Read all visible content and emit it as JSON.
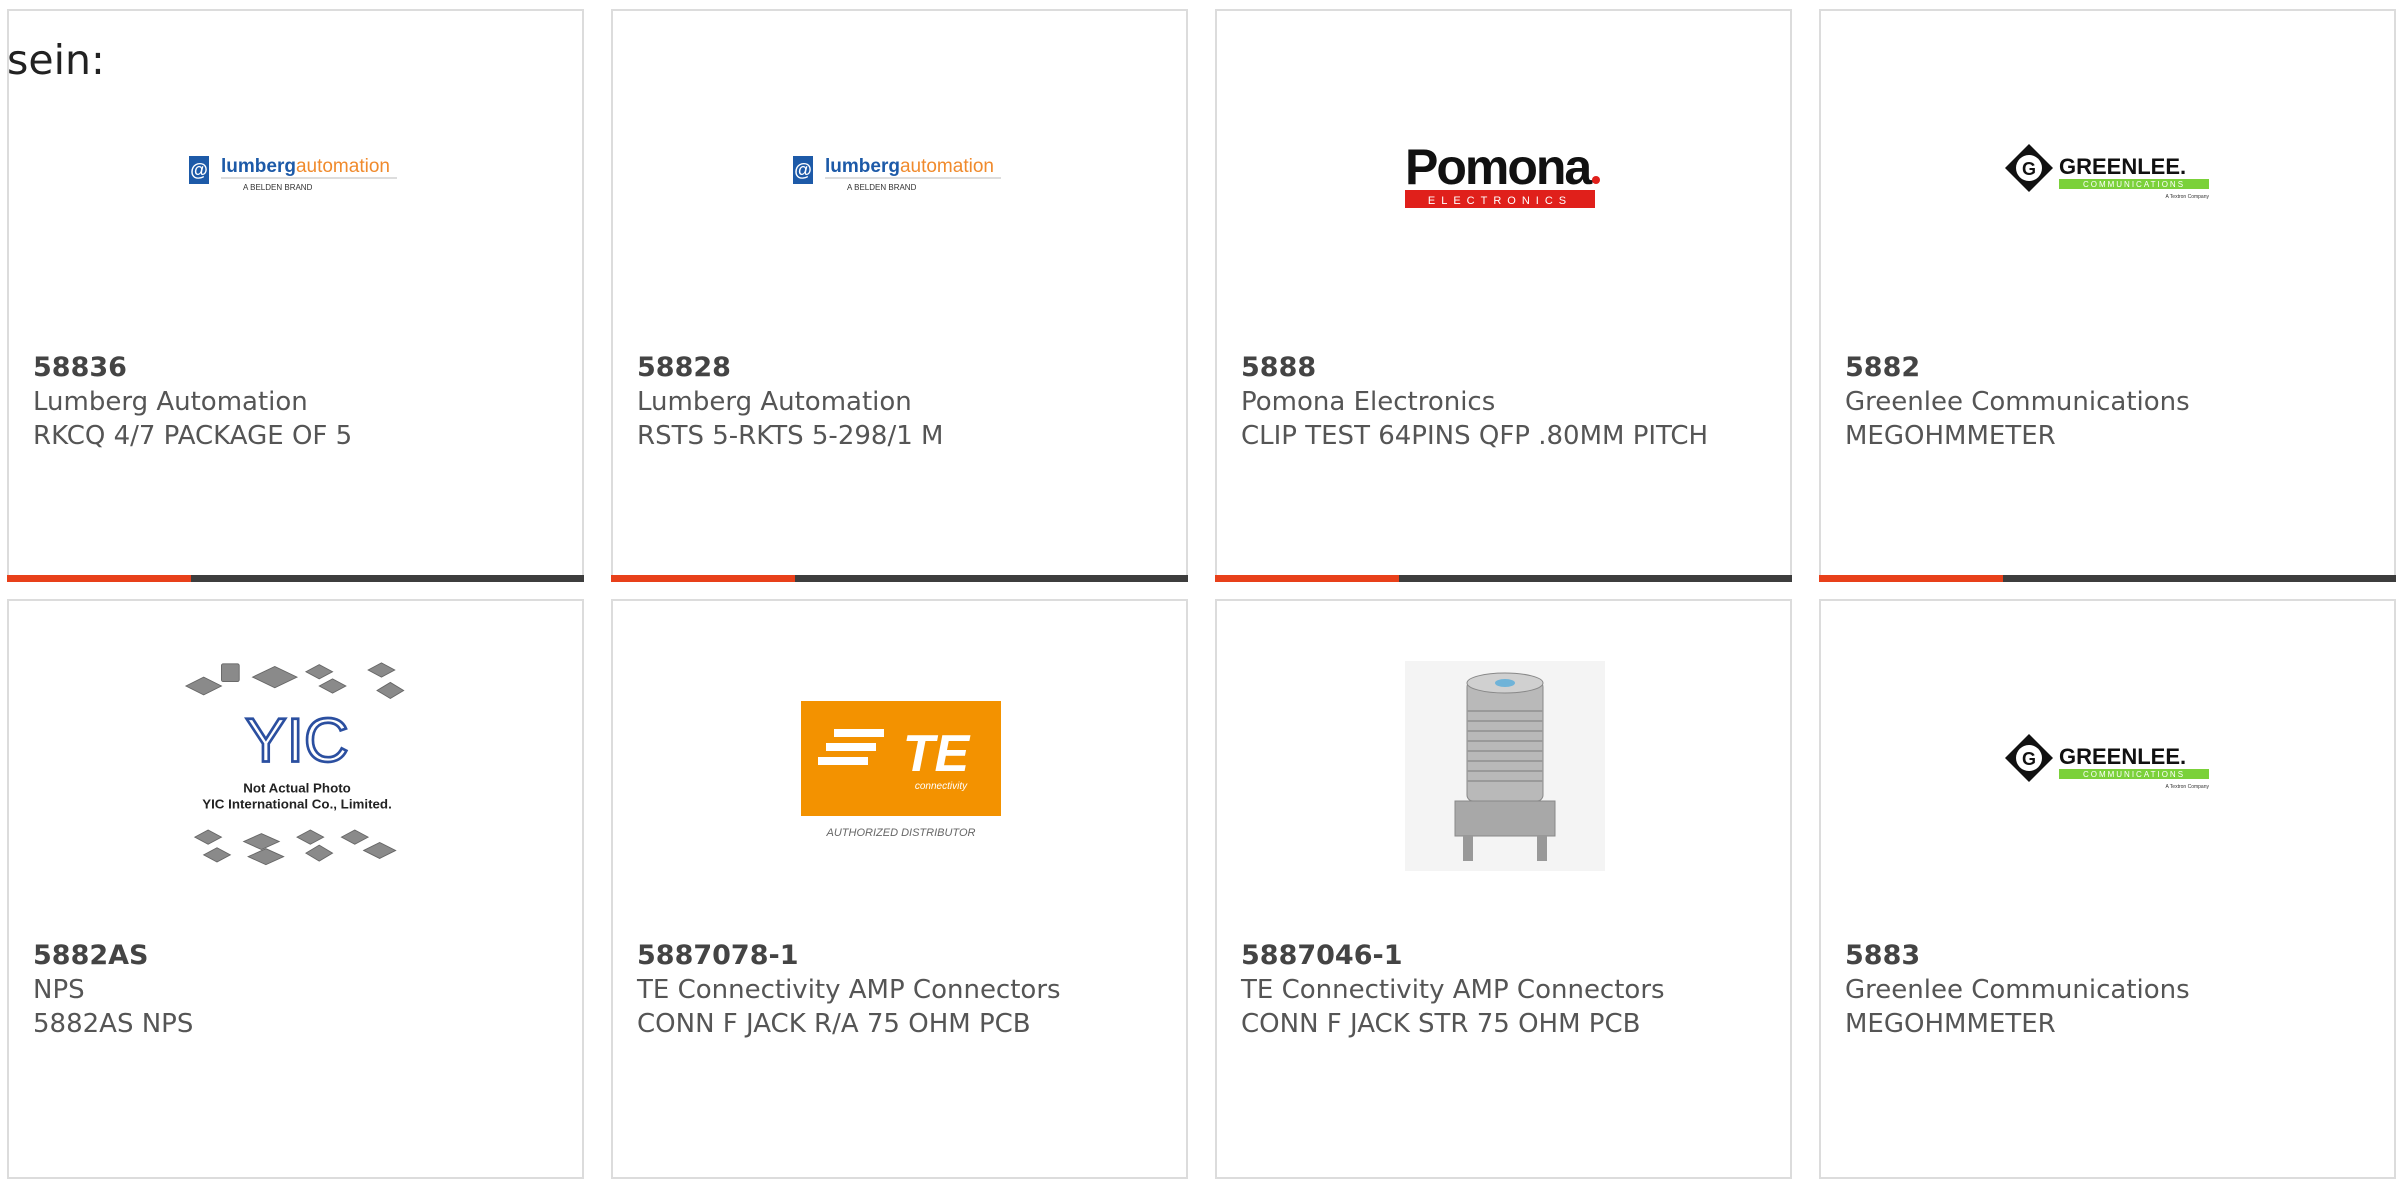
{
  "heading": "sein:",
  "accent_color": "#e8401a",
  "bar_color": "#3d3d3d",
  "products": [
    {
      "part": "58836",
      "manufacturer": "Lumberg Automation",
      "description": "RKCQ 4/7 PACKAGE OF 5",
      "logo": "lumberg-automation-logo",
      "logo_text": "lumbergautomation",
      "logo_sub": "A BELDEN BRAND"
    },
    {
      "part": "58828",
      "manufacturer": "Lumberg Automation",
      "description": "RSTS 5-RKTS 5-298/1 M",
      "logo": "lumberg-automation-logo",
      "logo_text": "lumbergautomation",
      "logo_sub": "A BELDEN BRAND"
    },
    {
      "part": "5888",
      "manufacturer": "Pomona Electronics",
      "description": "CLIP TEST 64PINS QFP .80MM PITCH",
      "logo": "pomona-logo",
      "logo_text": "Pomona.",
      "logo_sub": "ELECTRONICS"
    },
    {
      "part": "5882",
      "manufacturer": "Greenlee Communications",
      "description": "MEGOHMMETER",
      "logo": "greenlee-logo",
      "logo_text": "GREENLEE.",
      "logo_sub": "COMMUNICATIONS",
      "logo_sub2": "A Textron Company"
    },
    {
      "part": "5882AS",
      "manufacturer": "NPS",
      "description": "5882AS NPS",
      "logo": "yic-placeholder-image",
      "logo_text": "Not Actual Photo",
      "logo_sub": "YIC International Co., Limited."
    },
    {
      "part": "5887078-1",
      "manufacturer": "TE Connectivity AMP Connectors",
      "description": "CONN F JACK R/A 75 OHM PCB",
      "logo": "te-connectivity-logo",
      "logo_text": "TE",
      "logo_sub": "connectivity",
      "logo_sub2": "AUTHORIZED DISTRIBUTOR"
    },
    {
      "part": "5887046-1",
      "manufacturer": "TE Connectivity AMP Connectors",
      "description": "CONN F JACK STR 75 OHM PCB",
      "logo": "f-jack-connector-photo"
    },
    {
      "part": "5883",
      "manufacturer": "Greenlee Communications",
      "description": "MEGOHMMETER",
      "logo": "greenlee-logo",
      "logo_text": "GREENLEE.",
      "logo_sub": "COMMUNICATIONS",
      "logo_sub2": "A Textron Company"
    }
  ]
}
